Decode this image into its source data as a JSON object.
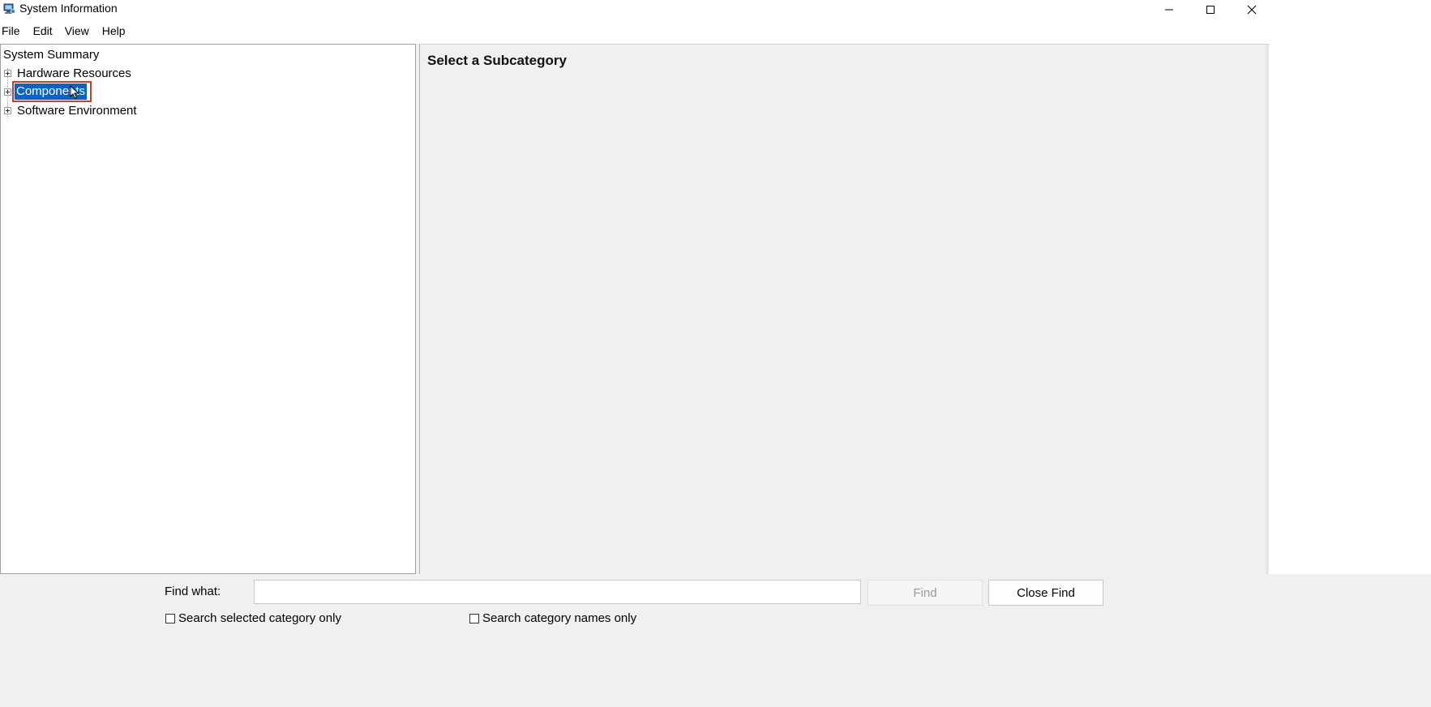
{
  "window": {
    "title": "System Information"
  },
  "menu": {
    "items": [
      "File",
      "Edit",
      "View",
      "Help"
    ]
  },
  "tree": {
    "root": "System Summary",
    "children": [
      {
        "label": "Hardware Resources"
      },
      {
        "label": "Components",
        "selected": true
      },
      {
        "label": "Software Environment"
      }
    ]
  },
  "detail": {
    "heading": "Select a Subcategory"
  },
  "find": {
    "label": "Find what:",
    "value": "",
    "find_button": "Find",
    "close_button": "Close Find",
    "option_selected_category": "Search selected category only",
    "option_category_names": "Search category names only"
  },
  "colors": {
    "selection_bg": "#0a64c8",
    "highlight_border": "#d13c21",
    "pane_bg": "#f0f0f0"
  }
}
